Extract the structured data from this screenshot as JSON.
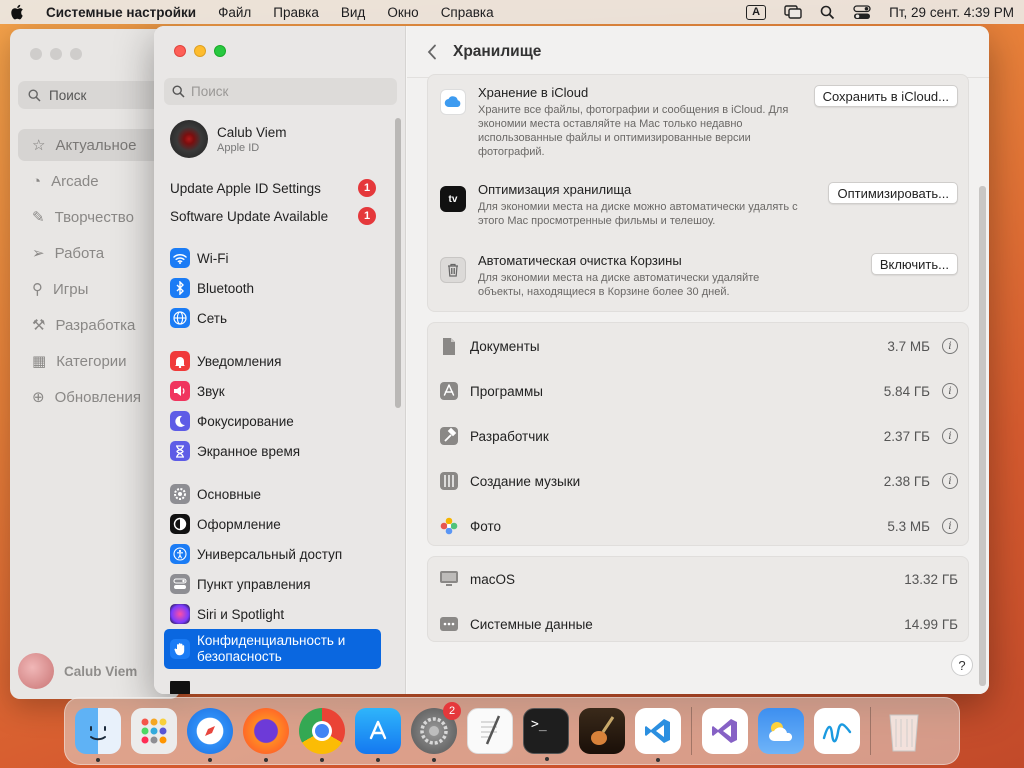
{
  "menubar": {
    "app_name": "Системные настройки",
    "items": [
      "Файл",
      "Правка",
      "Вид",
      "Окно",
      "Справка"
    ],
    "input_label": "A",
    "datetime": "Пт, 29 сент.  4:39 PM"
  },
  "background_window": {
    "search_label": "Поиск",
    "nav": [
      "Актуальное",
      "Arcade",
      "Творчество",
      "Работа",
      "Игры",
      "Разработка",
      "Категории",
      "Обновления"
    ],
    "user_name": "Calub Viem"
  },
  "sidebar": {
    "search_placeholder": "Поиск",
    "profile": {
      "name": "Calub Viem",
      "subtitle": "Apple ID"
    },
    "notifications": [
      {
        "label": "Update Apple ID Settings",
        "badge": "1"
      },
      {
        "label": "Software Update Available",
        "badge": "1"
      }
    ],
    "group1": [
      "Wi-Fi",
      "Bluetooth",
      "Сеть"
    ],
    "group2": [
      "Уведомления",
      "Звук",
      "Фокусирование",
      "Экранное время"
    ],
    "group3": [
      "Основные",
      "Оформление",
      "Универсальный доступ",
      "Пункт управления",
      "Siri и Spotlight",
      "Конфиденциальность и безопасность"
    ],
    "selected": "Конфиденциальность и безопасность"
  },
  "content": {
    "title": "Хранилище",
    "recommendations": [
      {
        "title": "Хранение в iCloud",
        "desc": "Храните все файлы, фотографии и сообщения в iCloud. Для экономии места оставляйте на Mac только недавно использованные файлы и оптимизированные версии фотографий.",
        "button": "Сохранить в iCloud..."
      },
      {
        "title": "Оптимизация хранилища",
        "desc": "Для экономии места на диске можно автоматически удалять с этого Mac просмотренные фильмы и телешоу.",
        "button": "Оптимизировать..."
      },
      {
        "title": "Автоматическая очистка Корзины",
        "desc": "Для экономии места на диске автоматически удаляйте объекты, находящиеся в Корзине более 30 дней.",
        "button": "Включить..."
      }
    ],
    "categories": [
      {
        "name": "Документы",
        "size": "3.7 МБ"
      },
      {
        "name": "Программы",
        "size": "5.84 ГБ"
      },
      {
        "name": "Разработчик",
        "size": "2.37 ГБ"
      },
      {
        "name": "Создание музыки",
        "size": "2.38 ГБ"
      },
      {
        "name": "Фото",
        "size": "5.3 МБ"
      }
    ],
    "system": [
      {
        "name": "macOS",
        "size": "13.32 ГБ"
      },
      {
        "name": "Системные данные",
        "size": "14.99 ГБ"
      }
    ],
    "help_label": "?"
  },
  "dock": {
    "settings_badge": "2",
    "apps": [
      "finder-icon",
      "launchpad-icon",
      "safari-icon",
      "firefox-icon",
      "chrome-icon",
      "app-store-icon",
      "system-settings-icon",
      "textedit-icon",
      "terminal-icon",
      "garageband-icon",
      "vscode-icon",
      "visual-studio-icon",
      "weather-icon",
      "freeform-icon",
      "trash-icon"
    ]
  },
  "colors": {
    "accent": "#0a67e0",
    "badge": "#e5383b"
  }
}
